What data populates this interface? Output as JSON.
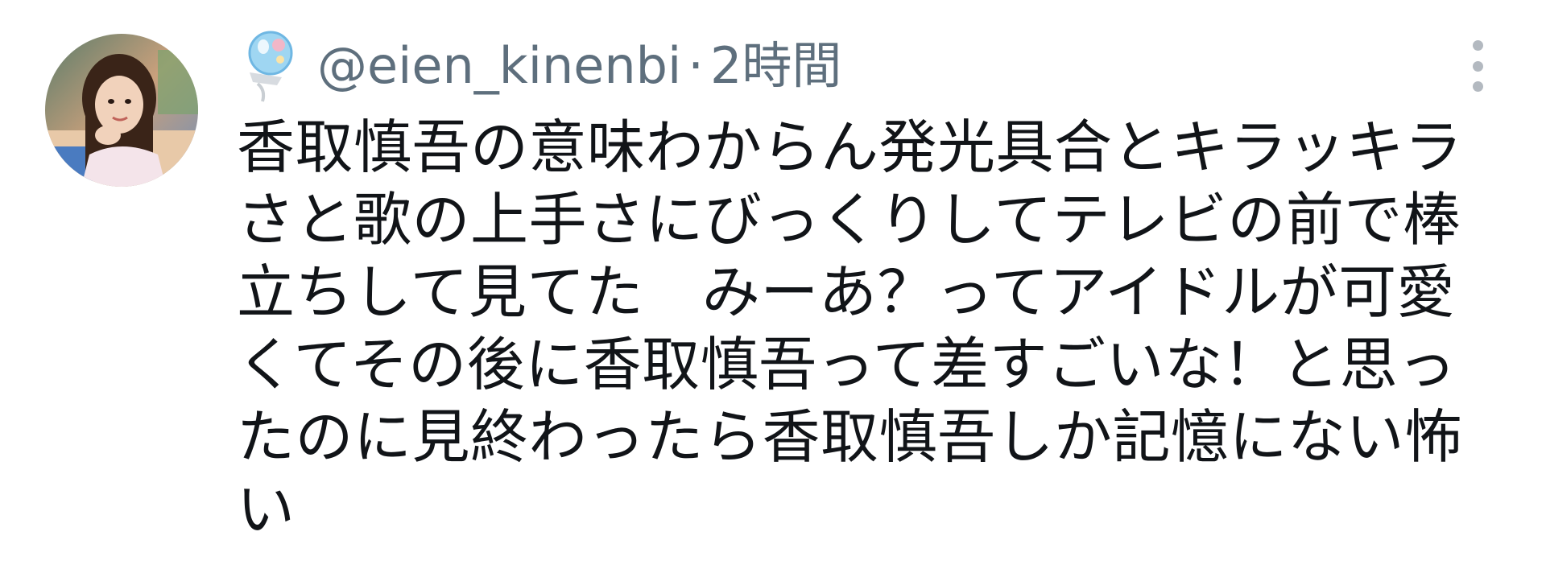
{
  "tweet": {
    "author": {
      "handle": "@eien_kinenbi",
      "badge_icon": "soda-float-balloon-icon",
      "avatar": "profile-photo"
    },
    "separator": "·",
    "time_ago": "2時間",
    "more_icon": "more-vertical-icon",
    "text": "香取慎吾の意味わからん発光具合とキラッキラさと歌の上手さにびっくりしてテレビの前で棒立ちして見てた　みーあ？ってアイドルが可愛くてその後に香取慎吾って差すごいな！と思ったのに見終わったら香取慎吾しか記憶にない怖い"
  },
  "colors": {
    "text": "#111418",
    "meta": "#5e6f7d",
    "more_dots": "#b3b9c0",
    "background": "#ffffff"
  }
}
